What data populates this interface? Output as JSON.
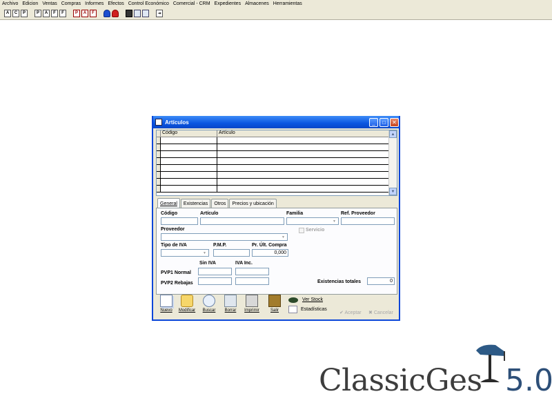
{
  "menu": [
    "Archivo",
    "Edicion",
    "Ventas",
    "Compras",
    "Informes",
    "Efectos",
    "Control Económico",
    "Comercial - CRM",
    "Expedientes",
    "Almacenes",
    "Herramientas"
  ],
  "toolbar_icons": [
    "art-icon",
    "cli-icon",
    "prov-icon",
    "pres-icon",
    "alb-icon",
    "fac-icon",
    "ped-icon",
    "alb-prov-icon",
    "fac-prov-icon",
    "blue-bag-icon",
    "red-bag-icon",
    "save-icon",
    "monitor-icon",
    "mail-icon",
    "exit-icon"
  ],
  "window": {
    "title": "Artículos",
    "grid": {
      "col_codigo": "Código",
      "col_articulo": "Artículo",
      "rows": 8
    },
    "tabs": [
      "General",
      "Existencias",
      "Otros",
      "Precios y ubicación"
    ],
    "form": {
      "codigo": "Código",
      "articulo": "Artículo",
      "familia": "Familia",
      "ref_proveedor": "Ref. Proveedor",
      "proveedor": "Proveedor",
      "servicio": "Servicio",
      "tipo_iva": "Tipo de IVA",
      "pmp": "P.M.P.",
      "pr_ult_compra": "Pr. Últ. Compra",
      "pr_ult_compra_value": "0,000",
      "sin_iva": "Sin IVA",
      "iva_inc": "IVA Inc.",
      "pvp1": "PVP1 Normal",
      "pvp2": "PVP2 Rebajas",
      "existencias_totales": "Existencias totales",
      "existencias_value": "0"
    },
    "buttons": {
      "nuevo": "Nuevo",
      "modificar": "Modificar",
      "buscar": "Buscar",
      "borrar": "Borrar",
      "imprimir": "Imprimir",
      "salir": "Salir",
      "ver_stock": "Ver Stock",
      "estadisticas": "Estadísticas",
      "aceptar": "Aceptar",
      "cancelar": "Cancelar"
    }
  },
  "logo": {
    "name": "ClassicGes",
    "version": "5.0"
  }
}
